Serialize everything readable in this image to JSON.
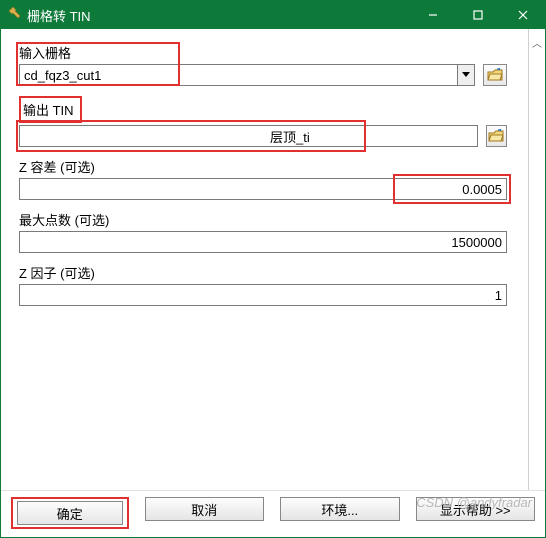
{
  "window": {
    "title": "栅格转 TIN"
  },
  "fields": {
    "input_raster": {
      "label": "输入栅格",
      "value": "cd_fqz3_cut1"
    },
    "output_tin": {
      "label": "输出 TIN",
      "value_prefix": "",
      "value_suffix": "层顶_ti"
    },
    "z_tolerance": {
      "label": "Z 容差 (可选)",
      "value": "0.0005"
    },
    "max_points": {
      "label": "最大点数 (可选)",
      "value": "1500000"
    },
    "z_factor": {
      "label": "Z 因子 (可选)",
      "value": "1"
    }
  },
  "buttons": {
    "ok": "确定",
    "cancel": "取消",
    "env": "环境...",
    "help": "显示帮助 >>"
  },
  "watermark": "CSDN @andyfradar"
}
